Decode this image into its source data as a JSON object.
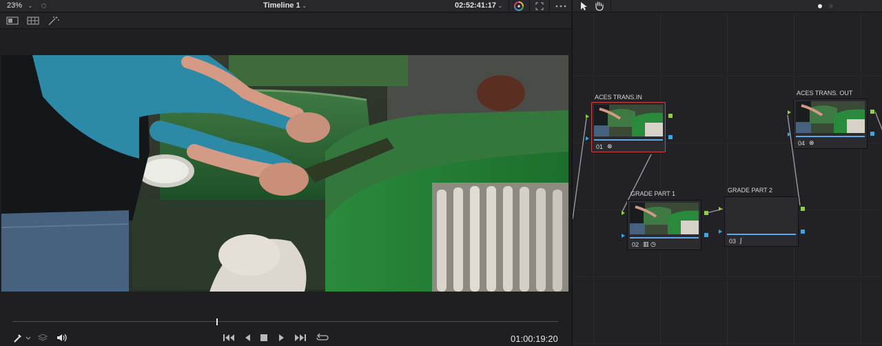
{
  "viewer": {
    "zoom": "23%",
    "timeline_name": "Timeline 1",
    "timecode_top": "02:52:41:17",
    "timecode_bottom": "01:00:19:20",
    "scrub_progress": 0.375
  },
  "toolbar_icons": [
    "single-viewer-icon",
    "grid-viewer-icon",
    "magic-wand-icon"
  ],
  "transport_icons": [
    "go-to-start-icon",
    "reverse-icon",
    "stop-icon",
    "play-icon",
    "go-to-end-icon",
    "loop-icon"
  ],
  "node_editor": {
    "tools": [
      "pointer-icon",
      "hand-icon"
    ],
    "nodes": [
      {
        "label": "ACES TRANS.IN",
        "number": "01",
        "selected": true,
        "icons": "⊗"
      },
      {
        "label": "GRADE PART 1",
        "number": "02",
        "selected": false,
        "icons": "▥ ◷"
      },
      {
        "label": "GRADE PART 2",
        "number": "03",
        "selected": false,
        "icons": "∫"
      },
      {
        "label": "ACES TRANS. OUT",
        "number": "04",
        "selected": false,
        "icons": "⊗"
      }
    ]
  },
  "colors": {
    "accent_red": "#d0453f",
    "port_green": "#8fd13f",
    "port_blue": "#39a7e6"
  }
}
